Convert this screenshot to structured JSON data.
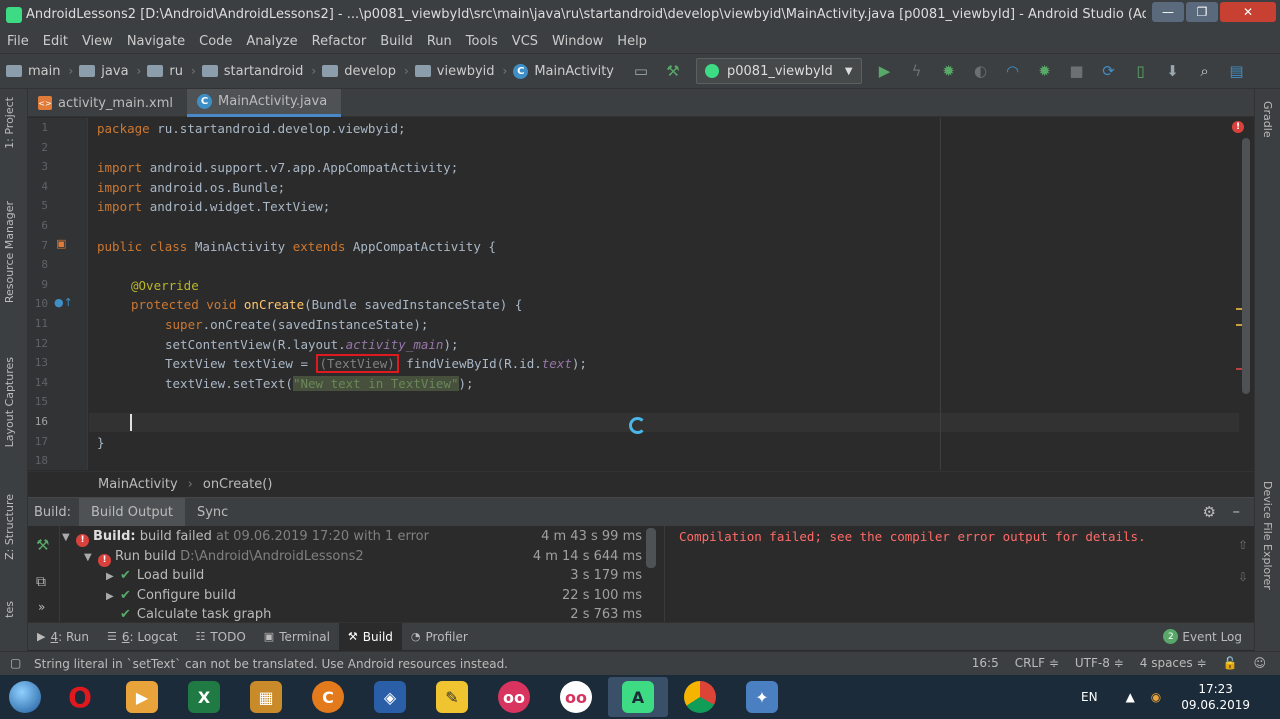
{
  "window": {
    "title": "AndroidLessons2 [D:\\Android\\AndroidLessons2] - ...\\p0081_viewbyId\\src\\main\\java\\ru\\startandroid\\develop\\viewbyid\\MainActivity.java [p0081_viewbyId] - Android Studio (Administr...",
    "minimize": "—",
    "maximize": "❐",
    "close": "✕"
  },
  "menu": [
    "File",
    "Edit",
    "View",
    "Navigate",
    "Code",
    "Analyze",
    "Refactor",
    "Build",
    "Run",
    "Tools",
    "VCS",
    "Window",
    "Help"
  ],
  "breadcrumbs": [
    "main",
    "java",
    "ru",
    "startandroid",
    "develop",
    "viewbyid",
    "MainActivity"
  ],
  "run_config": "p0081_viewbyId",
  "left_tabs": [
    "1: Project",
    "Resource Manager",
    "Layout Captures",
    "Z: Structure",
    "tes"
  ],
  "right_tabs": [
    "Gradle",
    "Device File Explorer"
  ],
  "editor_tabs": [
    {
      "label": "activity_main.xml",
      "icon": "xml-file-icon"
    },
    {
      "label": "MainActivity.java",
      "icon": "java-class-icon"
    }
  ],
  "line_numbers": [
    "1",
    "2",
    "3",
    "4",
    "5",
    "6",
    "7",
    "8",
    "9",
    "10",
    "11",
    "12",
    "13",
    "14",
    "15",
    "16",
    "17",
    "18"
  ],
  "code": {
    "l1_kw": "package ",
    "l1_rest": "ru.startandroid.develop.viewbyid;",
    "l3_kw": "import ",
    "l3_rest": "android.support.v7.app.AppCompatActivity;",
    "l4_kw": "import ",
    "l4_rest": "android.os.Bundle;",
    "l5_kw": "import ",
    "l5_rest": "android.widget.TextView;",
    "l7_kw1": "public class ",
    "l7_name": "MainActivity ",
    "l7_kw2": "extends ",
    "l7_rest": "AppCompatActivity {",
    "l9_ann": "@Override",
    "l10_kw": "protected void ",
    "l10_fn": "onCreate",
    "l10_rest": "(Bundle savedInstanceState) {",
    "l11_kw": "super",
    "l11_rest": ".onCreate(savedInstanceState);",
    "l12_a": "setContentView(R.layout.",
    "l12_it": "activity_main",
    "l12_b": ");",
    "l13_a": "TextView textView = ",
    "l13_cast": "(TextView)",
    "l13_b": " findViewById(R.id.",
    "l13_it": "text",
    "l13_c": ");",
    "l14_a": "textView.setText(",
    "l14_str": "\"New text in TextView\"",
    "l14_b": ");",
    "l17": "}"
  },
  "structure_crumbs": [
    "MainActivity",
    "onCreate()"
  ],
  "build": {
    "label": "Build:",
    "tabs": [
      "Build Output",
      "Sync"
    ],
    "rows": [
      {
        "bold": "Build:",
        "text": " build failed",
        "muted": " at 09.06.2019 17:20  with 1 error",
        "time": "4 m 43 s 99 ms"
      },
      {
        "text": "Run build ",
        "muted": "D:\\Android\\AndroidLessons2",
        "time": "4 m 14 s 644 ms"
      },
      {
        "text": "Load build",
        "time": "3 s 179 ms"
      },
      {
        "text": "Configure build",
        "time": "22 s 100 ms"
      },
      {
        "text": "Calculate task graph",
        "time": "2 s 763 ms"
      }
    ],
    "output": "Compilation failed; see the compiler error output for details."
  },
  "tool_windows": [
    {
      "num": "4",
      "label": ": Run",
      "icon": "▶"
    },
    {
      "num": "6",
      "label": ": Logcat",
      "icon": "☰"
    },
    {
      "num": "",
      "label": "TODO",
      "icon": "☷"
    },
    {
      "num": "",
      "label": "Terminal",
      "icon": "▣"
    },
    {
      "num": "",
      "label": "Build",
      "icon": "⚒"
    },
    {
      "num": "",
      "label": "Profiler",
      "icon": "◔"
    }
  ],
  "event_log": {
    "count": "2",
    "label": "Event Log"
  },
  "status": {
    "message": "String literal in `setText` can not be translated. Use Android resources instead.",
    "position": "16:5",
    "line_sep": "CRLF ≑",
    "encoding": "UTF-8 ≑",
    "indent": "4 spaces ≑"
  },
  "taskbar": {
    "lang": "EN",
    "time": "17:23",
    "date": "09.06.2019"
  },
  "colors": {
    "accent": "#4a88c7",
    "error": "#d9423c",
    "success": "#59a869"
  }
}
